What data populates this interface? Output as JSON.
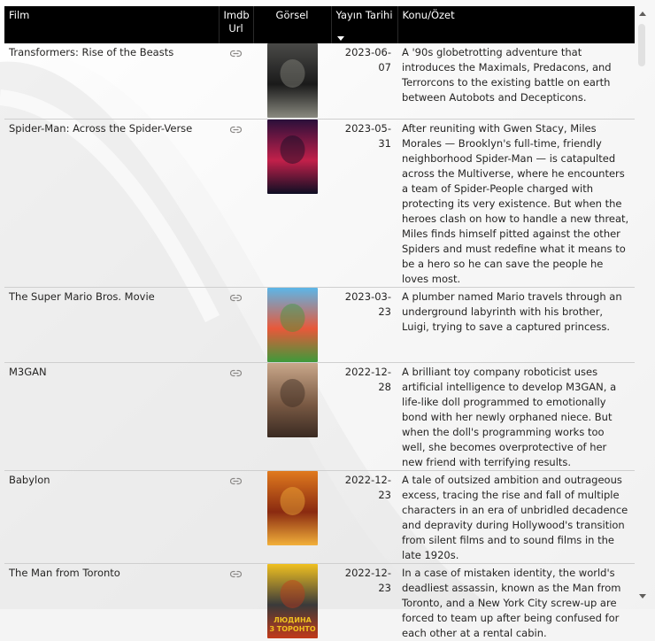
{
  "table": {
    "columns": [
      {
        "key": "film",
        "label": "Film"
      },
      {
        "key": "imdb",
        "label": "Imdb Url"
      },
      {
        "key": "image",
        "label": "Görsel"
      },
      {
        "key": "date",
        "label": "Yayın Tarihi",
        "sorted": "descending"
      },
      {
        "key": "summary",
        "label": "Konu/Özet"
      }
    ],
    "rows": [
      {
        "film": "Transformers: Rise of the Beasts",
        "imdb_icon": "link-icon",
        "date": "2023-06-07",
        "summary": "A '90s globetrotting adventure that introduces the Maximals, Predacons, and Terrorcons to the existing battle on earth between Autobots and Decepticons.",
        "poster_colors": [
          "#4a4a48",
          "#1a1a1a",
          "#8a8a80"
        ]
      },
      {
        "film": "Spider-Man: Across the Spider-Verse",
        "imdb_icon": "link-icon",
        "date": "2023-05-31",
        "summary": "After reuniting with Gwen Stacy, Miles Morales — Brooklyn's full-time, friendly neighborhood Spider-Man — is catapulted across the Multiverse, where he encounters a team of Spider-People charged with protecting its very existence. But when the heroes clash on how to handle a new threat, Miles finds himself pitted against the other Spiders and must redefine what it means to be a hero so he can save the people he loves most.",
        "poster_colors": [
          "#2a0f3a",
          "#c2204a",
          "#0e0e24"
        ]
      },
      {
        "film": "The Super Mario Bros. Movie",
        "imdb_icon": "link-icon",
        "date": "2023-03-23",
        "summary": "A plumber named Mario travels through an underground labyrinth with his brother, Luigi, trying to save a captured princess.",
        "poster_colors": [
          "#5cb6e8",
          "#e8583a",
          "#3e9a3a"
        ]
      },
      {
        "film": "M3GAN",
        "imdb_icon": "link-icon",
        "date": "2022-12-28",
        "summary": "A brilliant toy company roboticist uses artificial intelligence to develop M3GAN, a life-like doll programmed to emotionally bond with her newly orphaned niece. But when the doll's programming works too well, she becomes overprotective of her new friend with terrifying results.",
        "poster_colors": [
          "#c9a78a",
          "#7a5a44",
          "#3a2a22"
        ]
      },
      {
        "film": "Babylon",
        "imdb_icon": "link-icon",
        "date": "2022-12-23",
        "summary": "A tale of outsized ambition and outrageous excess, tracing the rise and fall of multiple characters in an era of unbridled decadence and depravity during Hollywood's transition from silent films and to sound films in the late 1920s.",
        "poster_colors": [
          "#e07a1e",
          "#8a2a10",
          "#f2b03a"
        ]
      },
      {
        "film": "The Man from Toronto",
        "imdb_icon": "link-icon",
        "date": "2022-12-23",
        "summary": "In a case of mistaken identity, the world's deadliest assassin, known as the Man from Toronto, and a New York City screw-up are forced to team up after being confused for each other at a rental cabin.",
        "poster_colors": [
          "#f0c020",
          "#3a3a3a",
          "#c23a1a"
        ],
        "poster_text": [
          "ЛЮДИНА",
          "З ТОРОНТО"
        ]
      }
    ]
  },
  "colors": {
    "header_bg": "#000000",
    "header_text": "#ffffff",
    "row_border": "#cfcfcf",
    "link_icon": "#8a8886"
  }
}
